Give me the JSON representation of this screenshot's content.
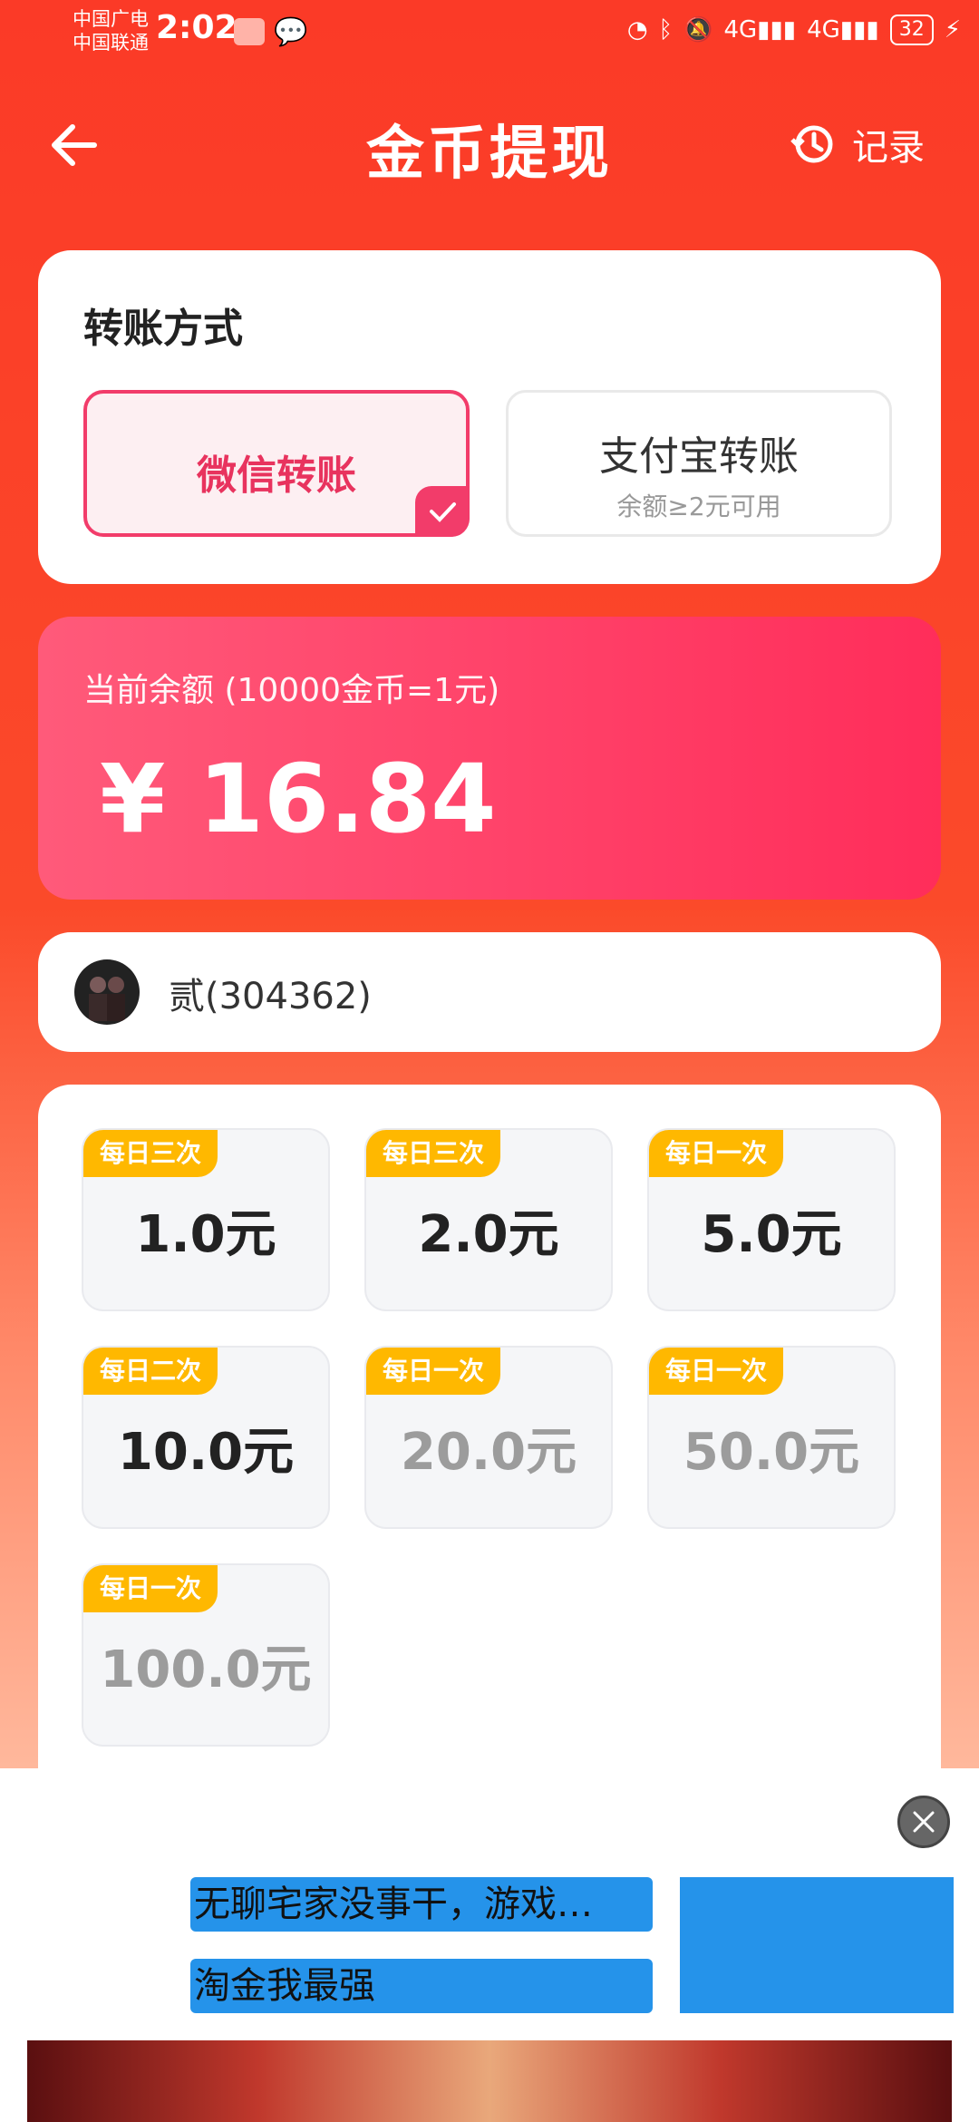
{
  "status_bar": {
    "carrier1": "中国广电",
    "carrier2": "中国联通",
    "time": "2:02",
    "battery": "32"
  },
  "header": {
    "title": "金币提现",
    "record_label": "记录"
  },
  "transfer": {
    "title": "转账方式",
    "options": [
      {
        "label": "微信转账",
        "sub": "",
        "selected": true
      },
      {
        "label": "支付宝转账",
        "sub": "余额≥2元可用",
        "selected": false
      }
    ]
  },
  "balance": {
    "label": "当前余额 (10000金币=1元)",
    "amount": "¥ 16.84"
  },
  "user": {
    "name": "贰(304362)"
  },
  "amounts": [
    {
      "badge": "每日三次",
      "value": "1.0元",
      "enabled": true
    },
    {
      "badge": "每日三次",
      "value": "2.0元",
      "enabled": true
    },
    {
      "badge": "每日一次",
      "value": "5.0元",
      "enabled": true
    },
    {
      "badge": "每日二次",
      "value": "10.0元",
      "enabled": true
    },
    {
      "badge": "每日一次",
      "value": "20.0元",
      "enabled": false
    },
    {
      "badge": "每日一次",
      "value": "50.0元",
      "enabled": false
    },
    {
      "badge": "每日一次",
      "value": "100.0元",
      "enabled": false
    }
  ],
  "ad": {
    "line1": "无聊宅家没事干，游戏…",
    "line2": "淘金我最强"
  },
  "colors": {
    "primary": "#fb3a27",
    "accent": "#f23c6a",
    "badge": "#ffb800"
  }
}
